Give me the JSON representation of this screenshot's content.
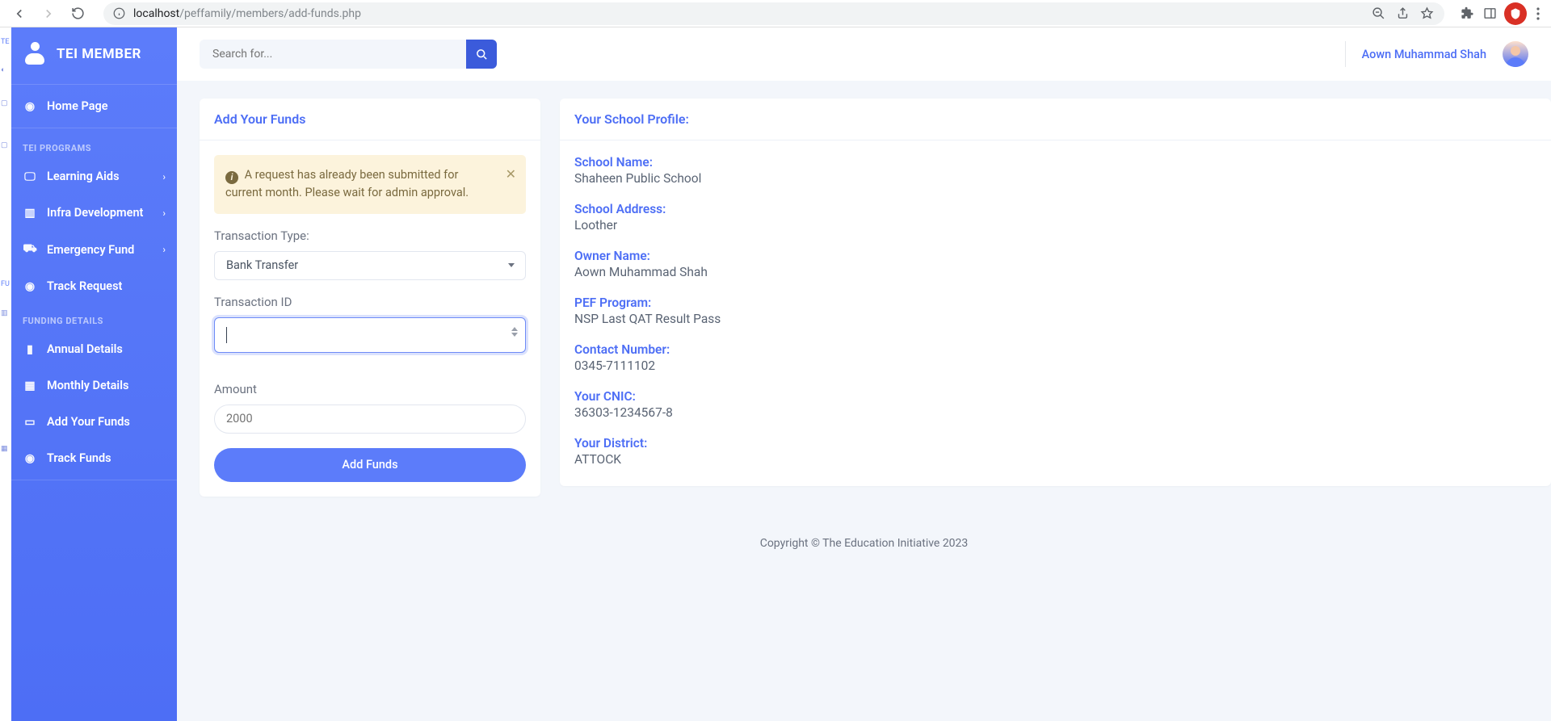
{
  "browser": {
    "url_host": "localhost",
    "url_path": "/peffamily/members/add-funds.php"
  },
  "brand": "TEI MEMBER",
  "nav": {
    "home": "Home Page",
    "section_programs": "TEI PROGRAMS",
    "learning_aids": "Learning Aids",
    "infra_dev": "Infra Development",
    "emergency_fund": "Emergency Fund",
    "track_request": "Track Request",
    "section_funding": "FUNDING DETAILS",
    "annual_details": "Annual Details",
    "monthly_details": "Monthly Details",
    "add_funds": "Add Your Funds",
    "track_funds": "Track Funds"
  },
  "hidden_sidebar": {
    "t0": "TE",
    "t1": "FU"
  },
  "search": {
    "placeholder": "Search for..."
  },
  "user": {
    "name": "Aown Muhammad Shah"
  },
  "add_funds_card": {
    "title": "Add Your Funds",
    "alert": "A request has already been submitted for current month. Please wait for admin approval.",
    "label_type": "Transaction Type:",
    "type_value": "Bank Transfer",
    "label_txid": "Transaction ID",
    "txid_value": "",
    "label_amount": "Amount",
    "amount_placeholder": "2000",
    "submit": "Add Funds"
  },
  "profile_card": {
    "title": "Your School Profile:",
    "school_name_label": "School Name:",
    "school_name_value": "Shaheen Public School",
    "address_label": "School Address:",
    "address_value": "Loother",
    "owner_label": "Owner Name:",
    "owner_value": "Aown Muhammad Shah",
    "program_label": "PEF Program:",
    "program_value": "NSP Last QAT Result Pass",
    "contact_label": "Contact Number:",
    "contact_value": "0345-7111102",
    "cnic_label": "Your CNIC:",
    "cnic_value": "36303-1234567-8",
    "district_label": "Your District:",
    "district_value": "ATTOCK"
  },
  "footer": "Copyright © The Education Initiative 2023"
}
